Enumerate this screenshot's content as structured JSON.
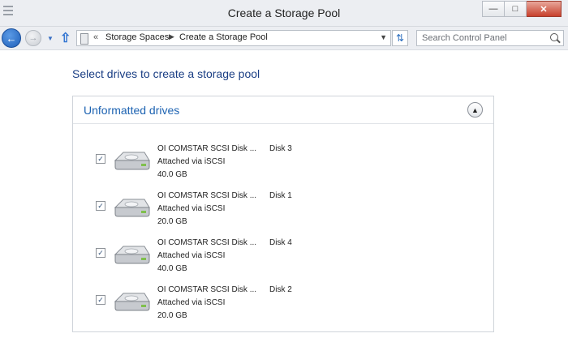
{
  "window": {
    "title": "Create a Storage Pool"
  },
  "navbar": {
    "breadcrumb_prefix": "«",
    "breadcrumbs": [
      "Storage Spaces",
      "Create a Storage Pool"
    ],
    "search_placeholder": "Search Control Panel"
  },
  "page": {
    "heading": "Select drives to create a storage pool"
  },
  "panel": {
    "title": "Unformatted drives",
    "drives": [
      {
        "name": "OI COMSTAR SCSI Disk ...",
        "disk": "Disk 3",
        "connection": "Attached via iSCSI",
        "size": "40.0 GB",
        "checked": true
      },
      {
        "name": "OI COMSTAR SCSI Disk ...",
        "disk": "Disk 1",
        "connection": "Attached via iSCSI",
        "size": "20.0 GB",
        "checked": true
      },
      {
        "name": "OI COMSTAR SCSI Disk ...",
        "disk": "Disk 4",
        "connection": "Attached via iSCSI",
        "size": "40.0 GB",
        "checked": true
      },
      {
        "name": "OI COMSTAR SCSI Disk ...",
        "disk": "Disk 2",
        "connection": "Attached via iSCSI",
        "size": "20.0 GB",
        "checked": true
      }
    ]
  },
  "icons": {
    "back": "arrow-left-icon",
    "forward": "arrow-right-icon",
    "up": "arrow-up-icon",
    "refresh": "refresh-icon",
    "search": "magnifier-icon",
    "drive": "hard-disk-icon",
    "collapse": "chevron-up-icon"
  },
  "colors": {
    "heading": "#1a3e84",
    "panel_title": "#1d63b2",
    "close_button": "#c7402c"
  }
}
